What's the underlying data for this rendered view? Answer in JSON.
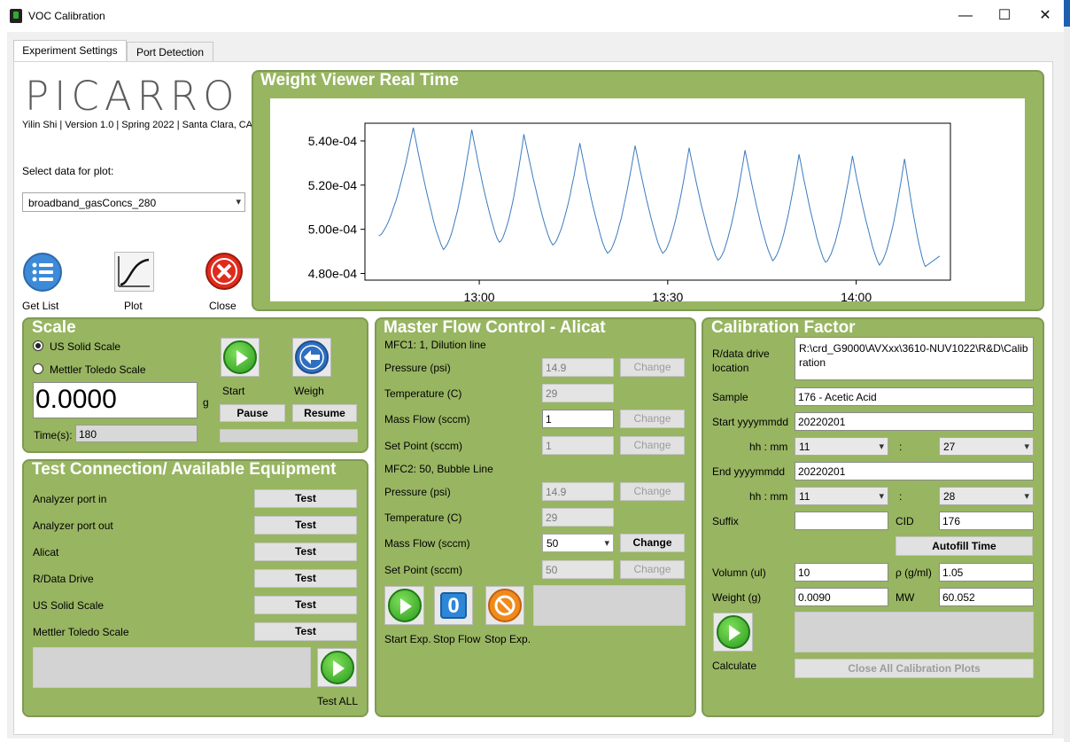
{
  "window": {
    "title": "VOC Calibration",
    "minimize": "—",
    "maximize": "☐",
    "close": "✕"
  },
  "tabs": [
    {
      "label": "Experiment Settings"
    },
    {
      "label": "Port Detection"
    }
  ],
  "brand": {
    "logo": "PICARRO",
    "credit": "Yilin Shi | Version 1.0 | Spring 2022 | Santa Clara, CA"
  },
  "plot_select": {
    "label": "Select data for plot:",
    "value": "broadband_gasConcs_280"
  },
  "tools": {
    "get_list": "Get List",
    "plot": "Plot",
    "close": "Close"
  },
  "weight_viewer": {
    "title": "Weight Viewer Real Time"
  },
  "chart_data": {
    "type": "line",
    "title": "",
    "ylim": [
      0.000477,
      0.000548
    ],
    "yticks": [
      "4.80e-04",
      "5.00e-04",
      "5.20e-04",
      "5.40e-04"
    ],
    "ytick_values": [
      0.00048,
      0.0005,
      0.00052,
      0.00054
    ],
    "xticks": [
      "13:00",
      "13:30",
      "14:00"
    ],
    "xtick_values": [
      "13:00",
      "13:30",
      "14:00"
    ],
    "x_range": [
      "12:44",
      "14:10"
    ],
    "peaks": [
      {
        "time": "12:49.5",
        "value": 0.000546
      },
      {
        "time": "12:58.8",
        "value": 0.000545
      },
      {
        "time": "13:07.1",
        "value": 0.000543
      },
      {
        "time": "13:16.0",
        "value": 0.000539
      },
      {
        "time": "13:24.8",
        "value": 0.000538
      },
      {
        "time": "13:33.4",
        "value": 0.000537
      },
      {
        "time": "13:42.3",
        "value": 0.000536
      },
      {
        "time": "13:50.9",
        "value": 0.000534
      },
      {
        "time": "13:59.4",
        "value": 0.000533
      },
      {
        "time": "14:07.7",
        "value": 0.000532
      }
    ],
    "troughs": [
      {
        "time": "12:44.0",
        "value": 0.000497
      },
      {
        "time": "12:54.3",
        "value": 0.000491
      },
      {
        "time": "13:03.2",
        "value": 0.000494
      },
      {
        "time": "13:11.7",
        "value": 0.000493
      },
      {
        "time": "13:20.4",
        "value": 0.000489
      },
      {
        "time": "13:29.2",
        "value": 0.000489
      },
      {
        "time": "13:38.0",
        "value": 0.000486
      },
      {
        "time": "13:46.7",
        "value": 0.000486
      },
      {
        "time": "13:55.1",
        "value": 0.000485
      },
      {
        "time": "14:03.7",
        "value": 0.000484
      },
      {
        "time": "14:11.0",
        "value": 0.000483
      }
    ],
    "last_point": {
      "time": "14:13.3",
      "value": 0.000488
    },
    "line_color": "#3b7bbf"
  },
  "scale": {
    "title": "Scale",
    "radio_us": "US Solid Scale",
    "radio_mettler": "Mettler Toledo Scale",
    "reading": "0.0000",
    "unit": "g",
    "time_label": "Time(s):",
    "time_value": "180",
    "start": "Start",
    "weigh": "Weigh",
    "pause": "Pause",
    "resume": "Resume"
  },
  "test_connection": {
    "title": "Test Connection/ Available Equipment",
    "items": [
      {
        "label": "Analyzer port in",
        "button": "Test"
      },
      {
        "label": "Analyzer port out",
        "button": "Test"
      },
      {
        "label": "Alicat",
        "button": "Test"
      },
      {
        "label": "R/Data Drive",
        "button": "Test"
      },
      {
        "label": "US Solid Scale",
        "button": "Test"
      },
      {
        "label": "Mettler Toledo Scale",
        "button": "Test"
      }
    ],
    "test_all": "Test ALL"
  },
  "mfc": {
    "title": "Master Flow Control - Alicat",
    "mfc1": {
      "header": "MFC1: 1, Dilution line",
      "pressure": "14.9",
      "temperature": "29",
      "mass_flow": "1",
      "set_point": "1"
    },
    "mfc2": {
      "header": "MFC2: 50, Bubble Line",
      "pressure": "14.9",
      "temperature": "29",
      "mass_flow": "50",
      "set_point": "50"
    },
    "labels": {
      "pressure": "Pressure (psi)",
      "temperature": "Temperature (C)",
      "mass_flow": "Mass Flow (sccm)",
      "set_point": "Set Point (sccm)"
    },
    "change": "Change",
    "start_exp": "Start Exp.",
    "stop_flow": "Stop Flow",
    "stop_exp": "Stop Exp.",
    "stop_flow_glyph": "0"
  },
  "calibration": {
    "title": "Calibration Factor",
    "drive_label": "R/data drive location",
    "drive_value": "R:\\crd_G9000\\AVXxx\\3610-NUV1022\\R&D\\Calibration",
    "sample_label": "Sample",
    "sample_value": "176 - Acetic Acid",
    "start_label": "Start yyyymmdd",
    "start_value": "20220201",
    "hhmm_label": "hh : mm",
    "start_hh": "11",
    "start_mm": "27",
    "end_label": "End yyyymmdd",
    "end_value": "20220201",
    "end_hh": "11",
    "end_mm": "28",
    "colon": ":",
    "suffix_label": "Suffix",
    "suffix_value": "",
    "cid_label": "CID",
    "cid_value": "176",
    "autofill": "Autofill Time",
    "volumn_label": "Volumn (ul)",
    "volumn_value": "10",
    "rho_label": "ρ (g/ml)",
    "rho_value": "1.05",
    "weight_label": "Weight (g)",
    "weight_value": "0.0090",
    "mw_label": "MW",
    "mw_value": "60.052",
    "calculate": "Calculate",
    "close_all": "Close All Calibration Plots"
  }
}
